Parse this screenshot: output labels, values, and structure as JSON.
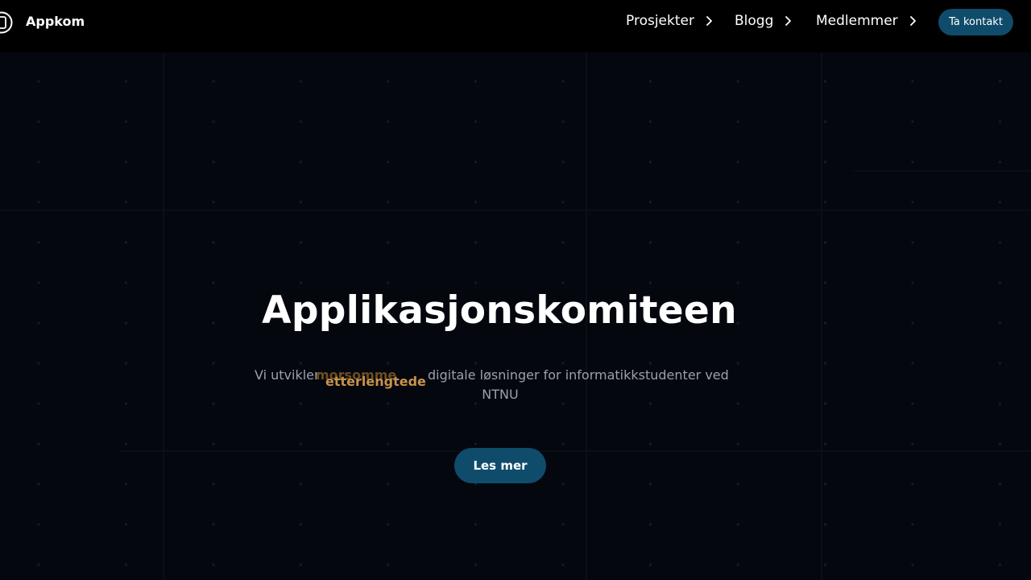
{
  "header": {
    "brand_name": "Appkom",
    "nav": [
      {
        "label": "Prosjekter"
      },
      {
        "label": "Blogg"
      },
      {
        "label": "Medlemmer"
      }
    ],
    "cta_label": "Ta kontakt"
  },
  "hero": {
    "title": "Applikasjonskomiteen",
    "subtitle_prefix": "Vi utvikler",
    "rotating_word_fading": "morsomme",
    "rotating_word": "etterlengtede",
    "subtitle_suffix": "digitale løsninger for informatikkstudenter ved",
    "subtitle_line2": "NTNU",
    "button_label": "Les mer"
  },
  "theme": {
    "background": "#05070f",
    "accent": "#0f4c6b",
    "highlight": "#c9924a",
    "muted_text": "#9aa0ac"
  },
  "icons": [
    "logo-icon",
    "chevron-right-icon"
  ]
}
